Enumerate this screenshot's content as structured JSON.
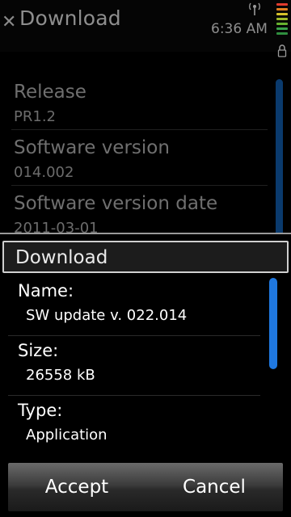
{
  "titlebar": {
    "title": "Download",
    "time": "6:36 AM",
    "icons": [
      "close-icon",
      "signal-icon",
      "battery-icon",
      "lock-icon"
    ]
  },
  "background_list": {
    "items": [
      {
        "label": "Release",
        "value": "PR1.2"
      },
      {
        "label": "Software version",
        "value": "014.002"
      },
      {
        "label": "Software version date",
        "value": "2011-03-01"
      }
    ]
  },
  "dialog": {
    "title": "Download",
    "fields": [
      {
        "label": "Name:",
        "value": "SW update v. 022.014"
      },
      {
        "label": "Size:",
        "value": "26558 kB"
      },
      {
        "label": "Type:",
        "value": "Application"
      }
    ],
    "buttons": {
      "accept": "Accept",
      "cancel": "Cancel"
    }
  },
  "colors": {
    "accent_scroll": "#1f78e0",
    "battery_levels": [
      "#e23b2e",
      "#e07f22",
      "#d6c12a",
      "#67b22e",
      "#3aa24a"
    ]
  }
}
